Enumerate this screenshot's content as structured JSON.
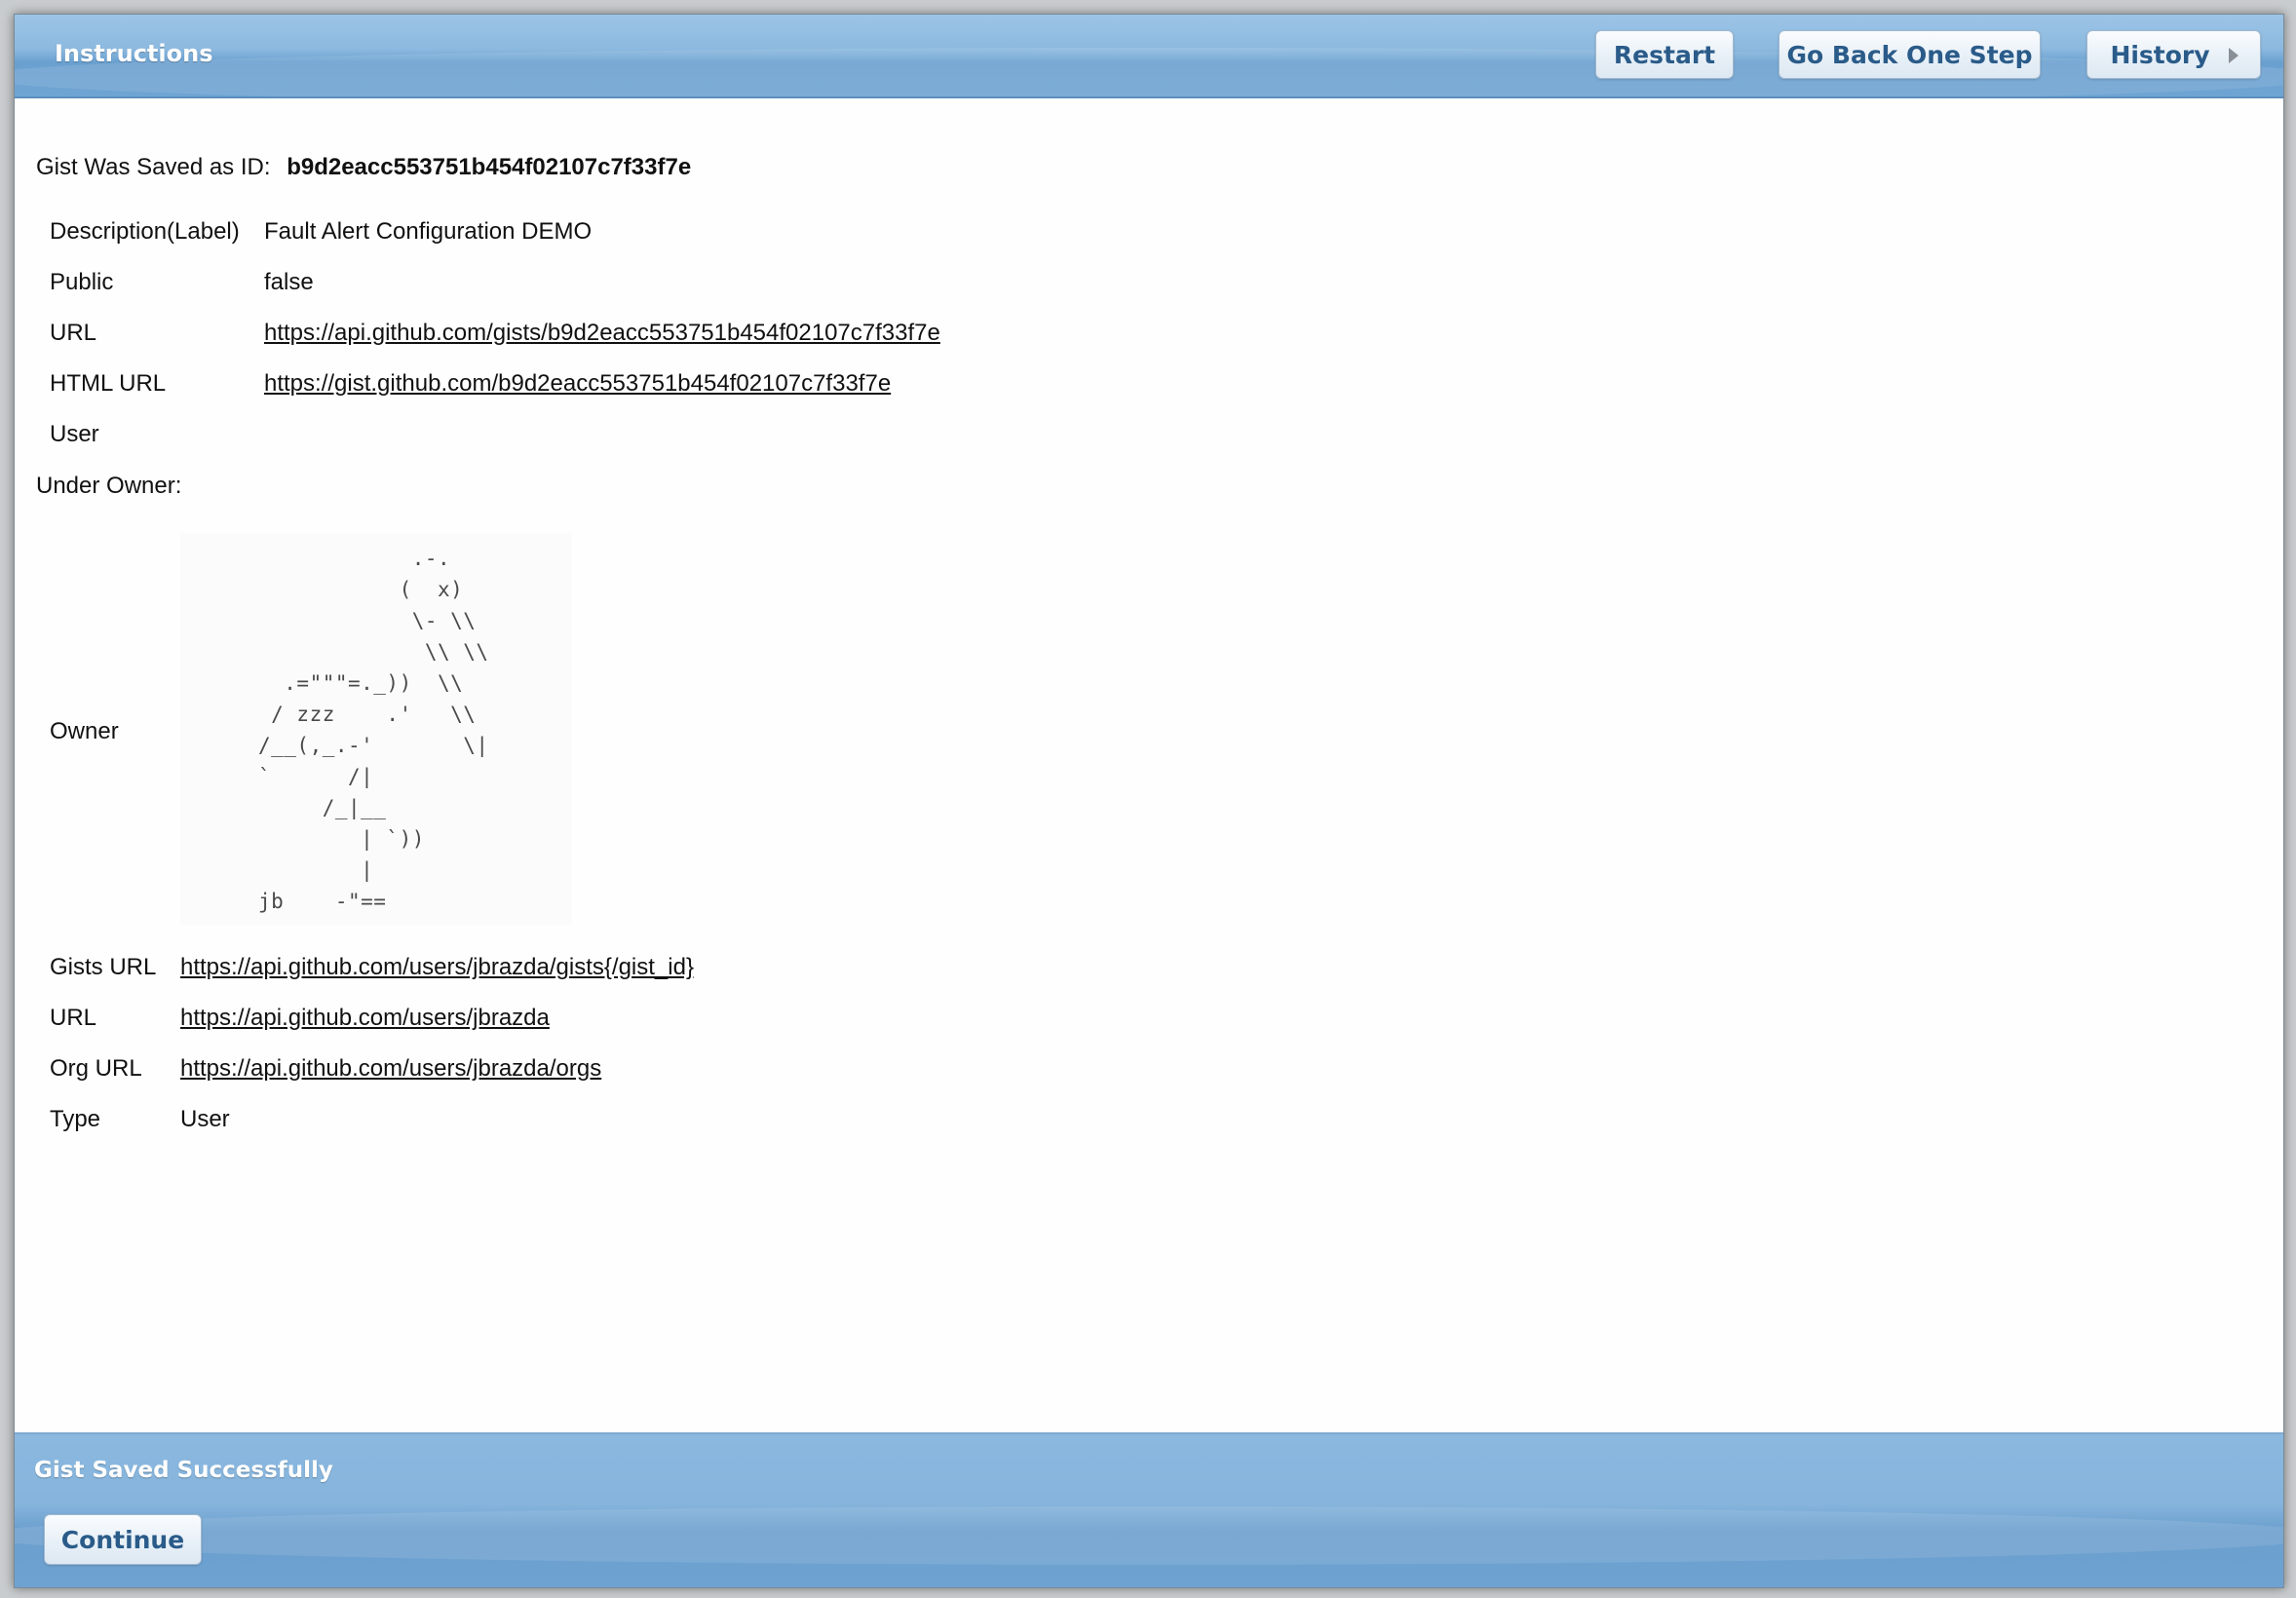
{
  "header": {
    "title": "Instructions",
    "buttons": {
      "restart": "Restart",
      "go_back": "Go Back One Step",
      "history": "History"
    }
  },
  "gist": {
    "saved_label": "Gist Was Saved as ID:",
    "id": "b9d2eacc553751b454f02107c7f33f7e",
    "details": [
      {
        "label": "Description(Label)",
        "value": "Fault Alert Configuration DEMO",
        "is_link": false
      },
      {
        "label": "Public",
        "value": "false",
        "is_link": false
      },
      {
        "label": "URL",
        "value": "https://api.github.com/gists/b9d2eacc553751b454f02107c7f33f7e",
        "is_link": true
      },
      {
        "label": "HTML URL",
        "value": "https://gist.github.com/b9d2eacc553751b454f02107c7f33f7e",
        "is_link": true
      },
      {
        "label": "User",
        "value": "",
        "is_link": false
      }
    ]
  },
  "owner": {
    "section_label": "Under Owner:",
    "owner_label": "Owner",
    "avatar_ascii": "            .-.\n           (  x)\n            \\- \\\\\n             \\\\ \\\\\n  .=\"\"\"=._))  \\\\\n / zzz    .'   \\\\\n/__(,_.-'       \\|\n`      /|\n     /_|__\n        | `))\n        |\njb    -\"==",
    "details": [
      {
        "label": "Gists URL",
        "value": "https://api.github.com/users/jbrazda/gists{/gist_id}",
        "is_link": true
      },
      {
        "label": "URL",
        "value": "https://api.github.com/users/jbrazda",
        "is_link": true
      },
      {
        "label": "Org URL",
        "value": "https://api.github.com/users/jbrazda/orgs",
        "is_link": true
      },
      {
        "label": "Type",
        "value": "User",
        "is_link": false
      }
    ]
  },
  "footer": {
    "status": "Gist Saved Successfully",
    "continue_label": "Continue"
  },
  "icons": {
    "history_arrow": "triangle-right-icon"
  },
  "colors": {
    "bar_blue": "#6fa4d3",
    "button_text": "#2a5b89"
  }
}
